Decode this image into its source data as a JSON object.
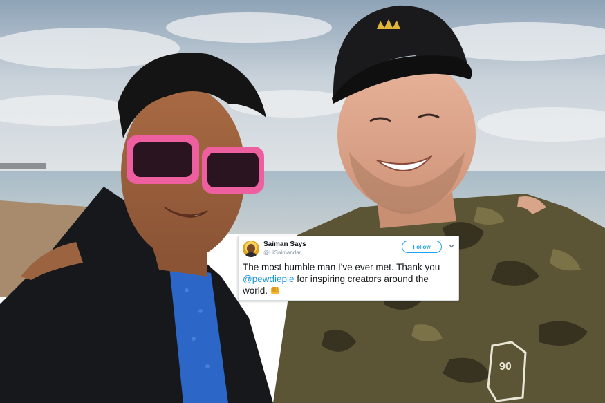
{
  "tweet": {
    "display_name": "Saiman Says",
    "handle": "@HiSaimandar",
    "follow_label": "Follow",
    "text_before": "The most humble man I've ever met. Thank you ",
    "mention": "@pewdiepie",
    "text_after": " for inspiring creators around the world.",
    "emoji_icon": "fist-bump-icon",
    "colors": {
      "accent": "#1da1f2",
      "link": "#1b95e0",
      "text": "#14171a",
      "muted": "#8899a6"
    }
  },
  "photo": {
    "cap_logo_icon": "crown-icon",
    "jacket_patch_text": "90"
  }
}
